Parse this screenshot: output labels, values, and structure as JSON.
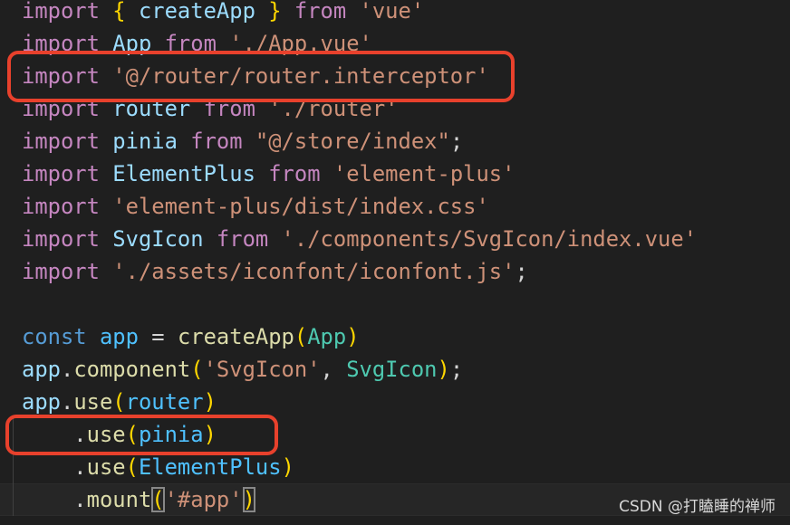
{
  "editor": {
    "language": "javascript",
    "current_line": 15,
    "lines": [
      [
        [
          "import",
          "kw"
        ],
        [
          " ",
          "plain"
        ],
        [
          "{",
          "brace"
        ],
        [
          " createApp ",
          "var"
        ],
        [
          "}",
          "brace"
        ],
        [
          " from ",
          "kw"
        ],
        [
          "'vue'",
          "str"
        ]
      ],
      [
        [
          "import",
          "kw"
        ],
        [
          " App ",
          "var"
        ],
        [
          "from",
          "kw"
        ],
        [
          " './App.vue'",
          "str"
        ]
      ],
      [
        [
          "import",
          "kw"
        ],
        [
          " '@/router/router.interceptor'",
          "str"
        ]
      ],
      [
        [
          "import",
          "kw"
        ],
        [
          " router ",
          "var"
        ],
        [
          "from",
          "kw"
        ],
        [
          " './router'",
          "str"
        ]
      ],
      [
        [
          "import",
          "kw"
        ],
        [
          " pinia ",
          "var"
        ],
        [
          "from",
          "kw"
        ],
        [
          " \"@/store/index\"",
          "str"
        ],
        [
          ";",
          "plain"
        ]
      ],
      [
        [
          "import",
          "kw"
        ],
        [
          " ElementPlus ",
          "var"
        ],
        [
          "from",
          "kw"
        ],
        [
          " 'element-plus'",
          "str"
        ]
      ],
      [
        [
          "import",
          "kw"
        ],
        [
          " 'element-plus/dist/index.css'",
          "str"
        ]
      ],
      [
        [
          "import",
          "kw"
        ],
        [
          " SvgIcon ",
          "var"
        ],
        [
          "from",
          "kw"
        ],
        [
          " './components/SvgIcon/index.vue'",
          "str"
        ]
      ],
      [
        [
          "import",
          "kw"
        ],
        [
          " './assets/iconfont/iconfont.js'",
          "str"
        ],
        [
          ";",
          "plain"
        ]
      ],
      [],
      [
        [
          "const",
          "storage"
        ],
        [
          " app ",
          "const"
        ],
        [
          "= ",
          "plain"
        ],
        [
          "createApp",
          "fn"
        ],
        [
          "(",
          "brace"
        ],
        [
          "App",
          "cls"
        ],
        [
          ")",
          "brace"
        ]
      ],
      [
        [
          "app",
          "var"
        ],
        [
          ".",
          "plain"
        ],
        [
          "component",
          "fn"
        ],
        [
          "(",
          "brace"
        ],
        [
          "'SvgIcon'",
          "str"
        ],
        [
          ", ",
          "plain"
        ],
        [
          "SvgIcon",
          "cls"
        ],
        [
          ")",
          "brace"
        ],
        [
          ";",
          "plain"
        ]
      ],
      [
        [
          "app",
          "var"
        ],
        [
          ".",
          "plain"
        ],
        [
          "use",
          "fn"
        ],
        [
          "(",
          "brace"
        ],
        [
          "router",
          "const"
        ],
        [
          ")",
          "brace"
        ]
      ],
      [
        [
          "    .",
          "plain"
        ],
        [
          "use",
          "fn"
        ],
        [
          "(",
          "brace"
        ],
        [
          "pinia",
          "const"
        ],
        [
          ")",
          "brace"
        ]
      ],
      [
        [
          "    .",
          "plain"
        ],
        [
          "use",
          "fn"
        ],
        [
          "(",
          "brace"
        ],
        [
          "ElementPlus",
          "const"
        ],
        [
          ")",
          "brace"
        ]
      ],
      [
        [
          "    .",
          "plain"
        ],
        [
          "mount",
          "fn"
        ],
        [
          "(",
          "brace match"
        ],
        [
          "'#app'",
          "str"
        ],
        [
          ")",
          "brace match"
        ]
      ]
    ]
  },
  "highlights": [
    "router-interceptor-import",
    "use-pinia"
  ],
  "colors": {
    "highlight_box": "#e8412c",
    "background": "#1f1f1f"
  },
  "watermark": "CSDN @打瞌睡的禅师"
}
